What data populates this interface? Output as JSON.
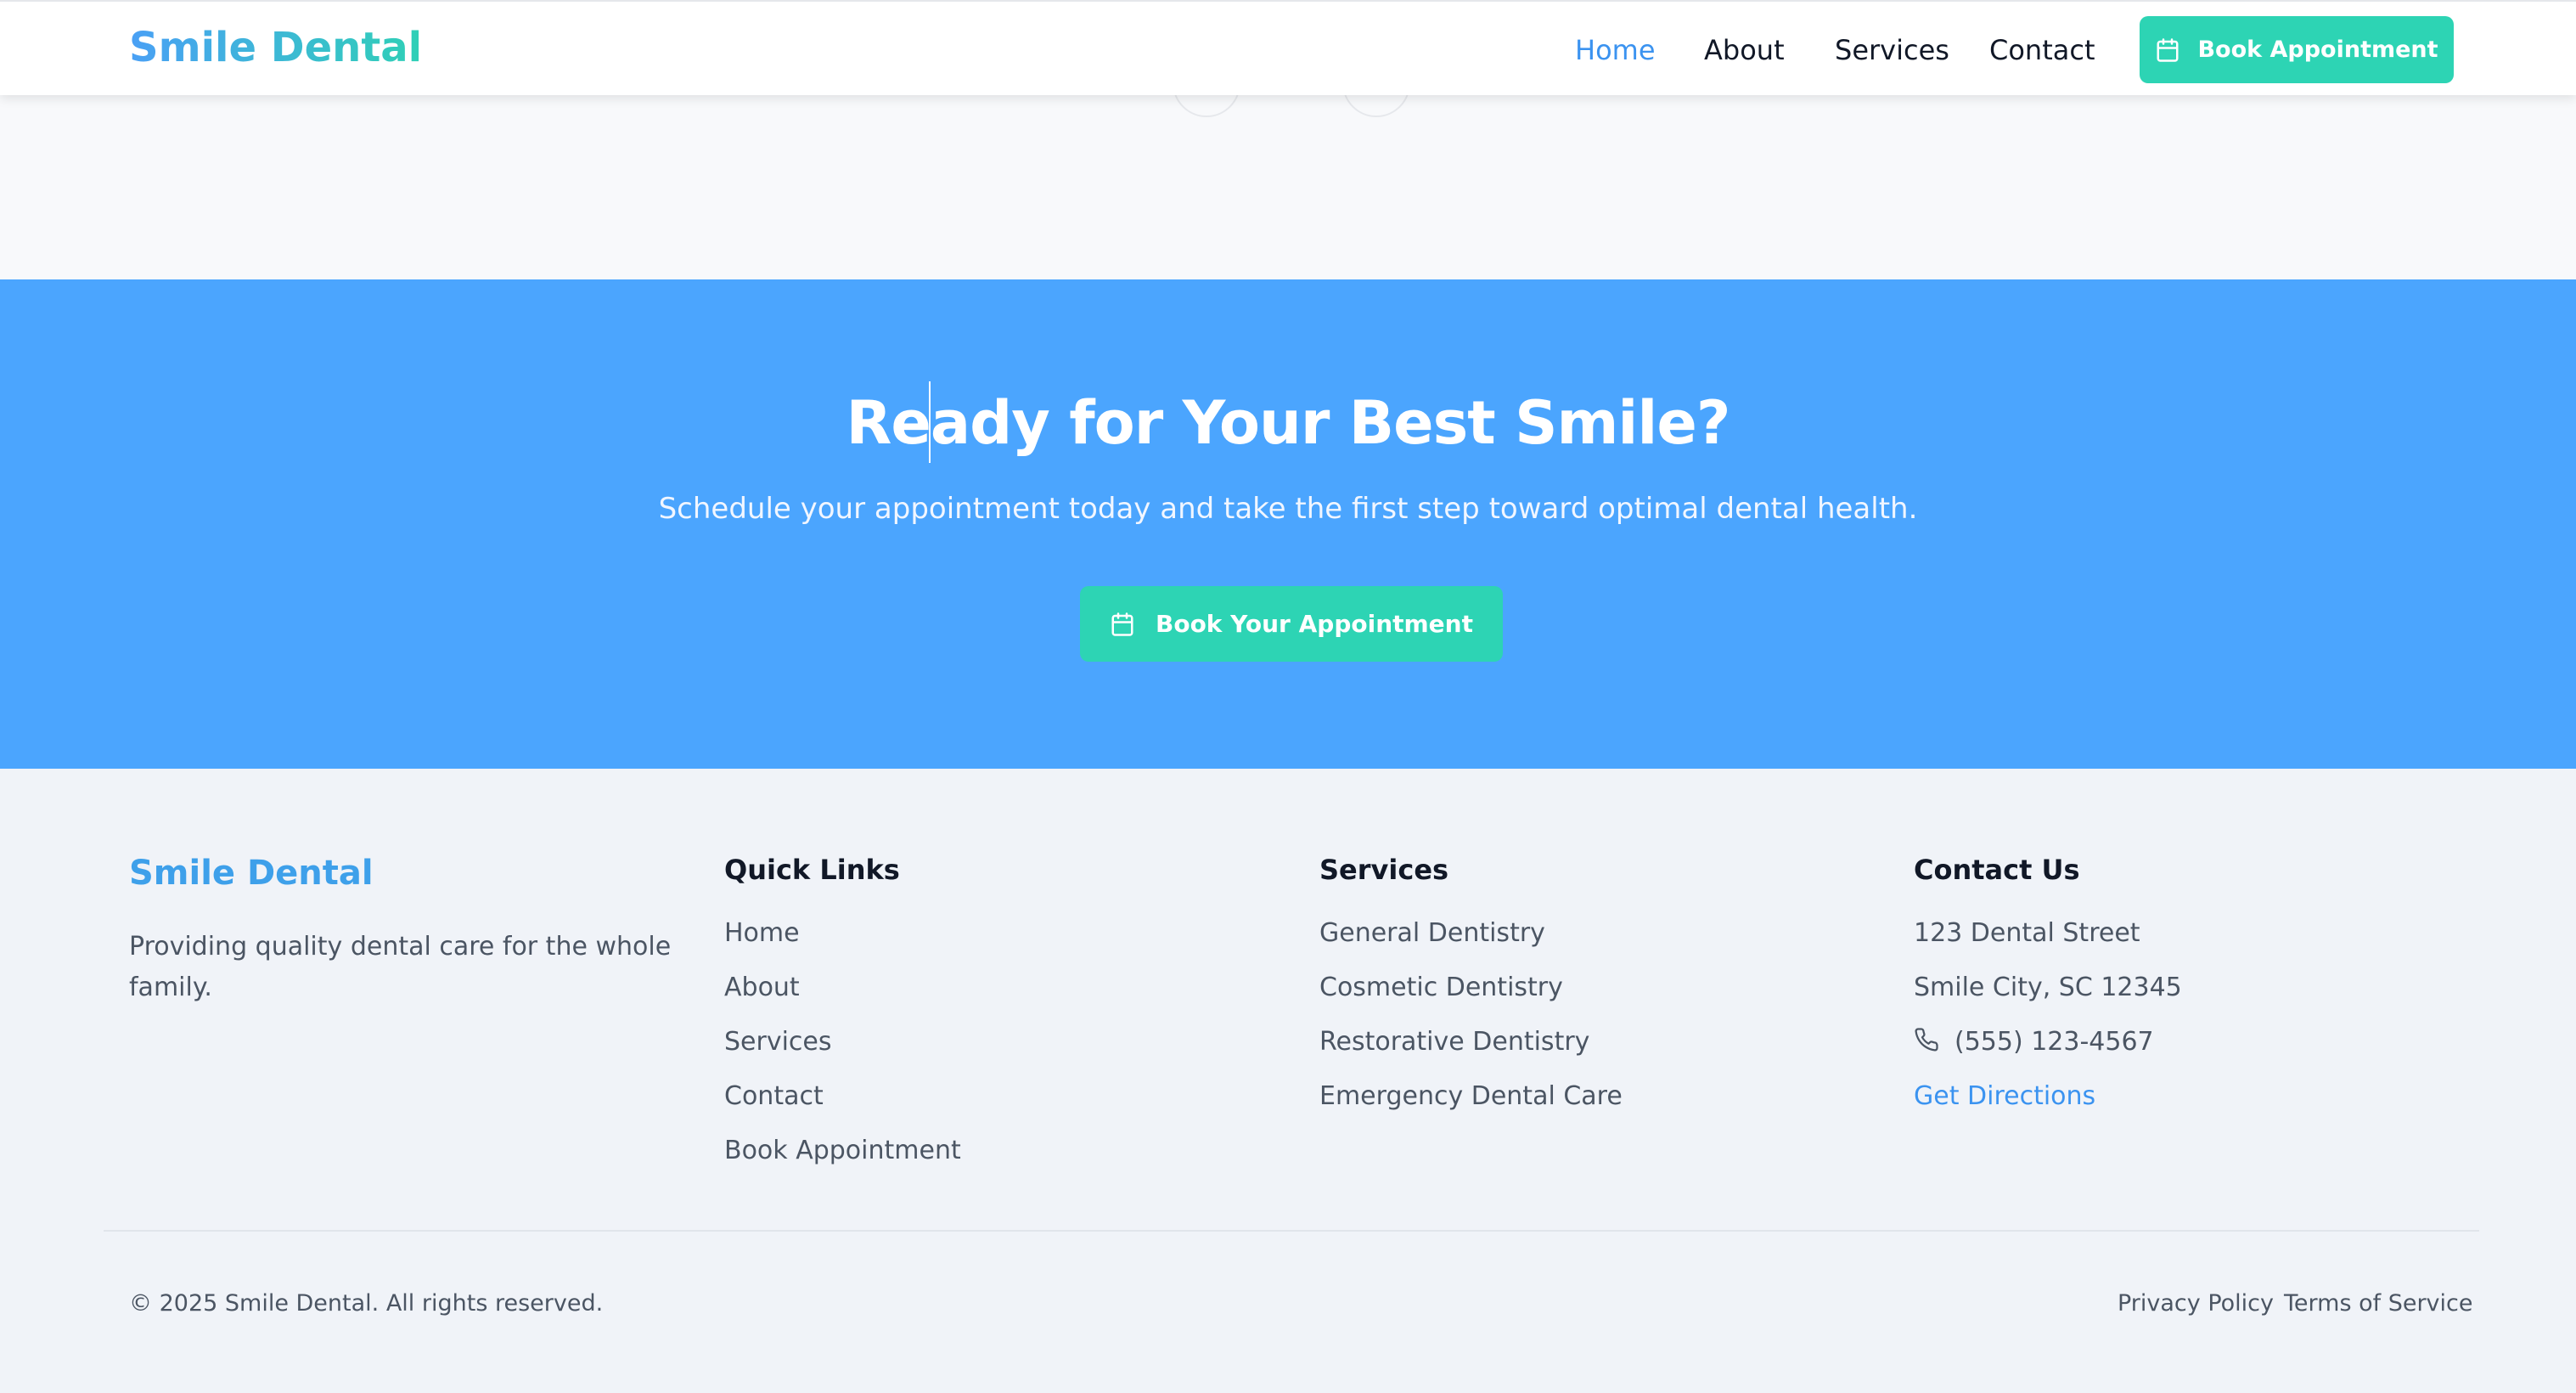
{
  "header": {
    "brand": "Smile Dental",
    "nav": [
      "Home",
      "About",
      "Services",
      "Contact"
    ],
    "active_nav": "Home",
    "book_label": "Book Appointment"
  },
  "cta": {
    "title": "Ready for Your Best Smile?",
    "subtitle": "Schedule your appointment today and take the first step toward optimal dental health.",
    "button_label": "Book Your Appointment"
  },
  "footer": {
    "brand": "Smile Dental",
    "description": "Providing quality dental care for the whole family.",
    "quick_links": {
      "heading": "Quick Links",
      "items": [
        "Home",
        "About",
        "Services",
        "Contact",
        "Book Appointment"
      ]
    },
    "services": {
      "heading": "Services",
      "items": [
        "General Dentistry",
        "Cosmetic Dentistry",
        "Restorative Dentistry",
        "Emergency Dental Care"
      ]
    },
    "contact": {
      "heading": "Contact Us",
      "street": "123 Dental Street",
      "city": "Smile City, SC 12345",
      "phone": "(555) 123-4567",
      "directions": "Get Directions"
    },
    "copyright": "© 2025 Smile Dental. All rights reserved.",
    "legal": [
      "Privacy Policy",
      "Terms of Service"
    ]
  },
  "colors": {
    "primary_blue": "#4ba5fe",
    "teal": "#2dd4b4",
    "link_blue": "#3b93f0",
    "footer_bg": "#f0f3f8"
  },
  "icons": {
    "calendar": "calendar-icon",
    "phone": "phone-icon"
  }
}
